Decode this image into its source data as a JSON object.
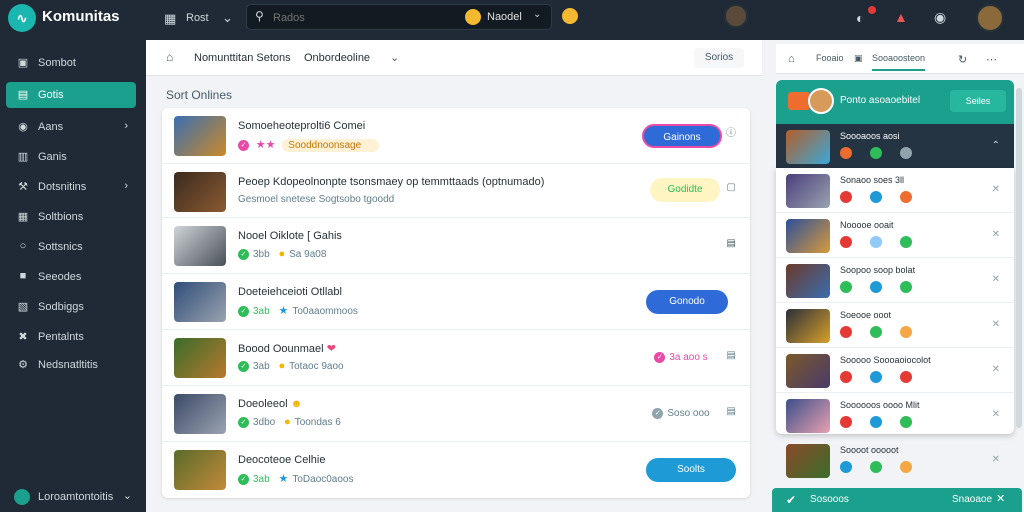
{
  "app": {
    "title": "Komunitas",
    "logo_glyph": "∿"
  },
  "topbar": {
    "menu_label": "Rost",
    "search_placeholder": "Rados",
    "search_chip": "Naodel"
  },
  "sidebar": {
    "items": [
      {
        "icon": "grid-icon",
        "glyph": "▣",
        "label": "Sombot",
        "active": false,
        "chevron": false
      },
      {
        "icon": "table-icon",
        "glyph": "▤",
        "label": "Gotis",
        "active": true,
        "chevron": false
      },
      {
        "icon": "eye-icon",
        "glyph": "◉",
        "label": "Aans",
        "active": false,
        "chevron": true
      },
      {
        "icon": "chart-icon",
        "glyph": "▥",
        "label": "Ganis",
        "active": false,
        "chevron": false
      },
      {
        "icon": "wrench-icon",
        "glyph": "⚒",
        "label": "Dotsnitins",
        "active": false,
        "chevron": true
      },
      {
        "icon": "doc-icon",
        "glyph": "▦",
        "label": "Soltbions",
        "active": false,
        "chevron": false
      },
      {
        "icon": "chat-icon",
        "glyph": "○",
        "label": "Sottsnics",
        "active": false,
        "chevron": false
      },
      {
        "icon": "inbox-icon",
        "glyph": "■",
        "label": "Seeodes",
        "active": false,
        "chevron": false
      },
      {
        "icon": "calendar-icon",
        "glyph": "▧",
        "label": "Sodbiggs",
        "active": false,
        "chevron": false
      },
      {
        "icon": "tools-icon",
        "glyph": "✖",
        "label": "Pentalnts",
        "active": false,
        "chevron": false
      },
      {
        "icon": "settings-icon",
        "glyph": "⚙",
        "label": "Nedsnatltitis",
        "active": false,
        "chevron": false
      }
    ],
    "footer_label": "Loroamtontoitis"
  },
  "main": {
    "header": {
      "title": "Nomunttitan Setons",
      "dropdown": "Onbordeoline",
      "button": "Sorios"
    },
    "section_label": "Sort Onlines",
    "rows": [
      {
        "thumb_color": "#3b6fb0",
        "title": "Somoeheoteprolti6 Comei",
        "sub_a": "",
        "sub_b": "Sooddnoonsage",
        "sub_type": "badge",
        "pill": "Gainons",
        "pill_style": "pink"
      },
      {
        "thumb_color": "#6b4a2e",
        "title": "Peoep Kdopeolnonpte tsonsmaey op temmttaads (optnumado)",
        "sub_a": "",
        "sub_b": "Gesmoel snetese Sogtsobo tgoodd",
        "sub_type": "plain",
        "pill": "Godidte",
        "pill_style": "yellow"
      },
      {
        "thumb_color": "#8a9299",
        "title": "Nooel Oiklote [ Gahis",
        "sub_a": "3bb",
        "sub_b": "Sa 9a08",
        "sub_type": "check",
        "pill": "",
        "pill_style": ""
      },
      {
        "thumb_color": "#2f4d7a",
        "title": "Doeteiehceioti Otllabl",
        "sub_a": "3ab",
        "sub_b": "To0aaommoos",
        "sub_type": "checkstar",
        "pill": "Gonodo",
        "pill_style": "blue"
      },
      {
        "thumb_color": "#3a6d2b",
        "title": "Boood Oounmael",
        "sub_a": "3ab",
        "sub_b": "Totaoc 9aoo",
        "sub_type": "check",
        "pill": "3a aoo s",
        "pill_style": "pinktext"
      },
      {
        "thumb_color": "#3d4a68",
        "title": "Doeoleeol",
        "sub_a": "3dbo",
        "sub_b": "Toondas 6",
        "sub_type": "check",
        "pill": "Soso ooo",
        "pill_style": "gray"
      },
      {
        "thumb_color": "#5a6b2a",
        "title": "Deocoteoe Celhie",
        "sub_a": "3ab",
        "sub_b": "ToDaoc0aoos",
        "sub_type": "checkstar",
        "pill": "Soolts",
        "pill_style": "teal"
      }
    ]
  },
  "right_panel": {
    "tabs": [
      "Fooaio",
      "Sooaoosteon",
      ""
    ],
    "card_title": "Ponto asoaoebitel",
    "card_button": "Seiles",
    "dark_item": {
      "name": "Soooaoos aosi",
      "thumb_color": "#b45e2a"
    },
    "items": [
      {
        "name": "Sonaoo soes 3ll",
        "thumb_color": "#4a3f7a"
      },
      {
        "name": "Nooooe ooait",
        "thumb_color": "#2c4f9a"
      },
      {
        "name": "Soopoo soop bolat",
        "thumb_color": "#6b3a2a"
      },
      {
        "name": "Soeooe ooot",
        "thumb_color": "#2b2f3a"
      },
      {
        "name": "Sooooo Soooaoiocolot",
        "thumb_color": "#7b5a2a"
      },
      {
        "name": "Soooooos oooo Mlit",
        "thumb_color": "#3b4f8a"
      }
    ],
    "bottom_item": {
      "name": "Soooot ooooot",
      "thumb_color": "#8a4a2a"
    },
    "footer_label": "Sosooos",
    "footer_status": "Snaoaoe"
  }
}
